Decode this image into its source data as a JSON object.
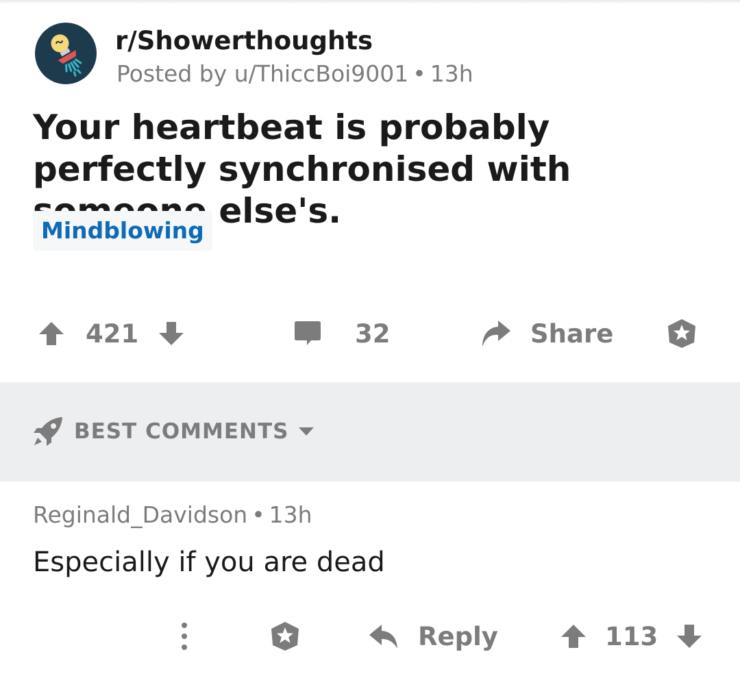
{
  "colors": {
    "text": "#1a1a1b",
    "muted": "#7c7c7c",
    "flair_text": "#0e6bb5",
    "flair_bg": "#f6f7f8",
    "sort_bar_bg": "#edeef0",
    "avatar_bg": "#1d3b4c",
    "avatar_accent": "#e1545a",
    "avatar_bulb": "#f6d77c",
    "avatar_water": "#35b8c9"
  },
  "post": {
    "subreddit": "r/Showerthoughts",
    "posted_by": "Posted by u/ThiccBoi9001",
    "separator": "•",
    "age": "13h",
    "title": "Your heartbeat is probably perfectly synchronised with someone else's.",
    "flair": "Mindblowing",
    "score": "421",
    "comments": "32",
    "share_label": "Share",
    "avatar_icon": "showerthoughts-avatar-icon"
  },
  "sort": {
    "label": "BEST COMMENTS",
    "icon": "rocket-icon"
  },
  "comment": {
    "author": "Reginald_Davidson",
    "separator": "•",
    "age": "13h",
    "body": "Especially if you are dead",
    "reply_label": "Reply",
    "score": "113"
  }
}
